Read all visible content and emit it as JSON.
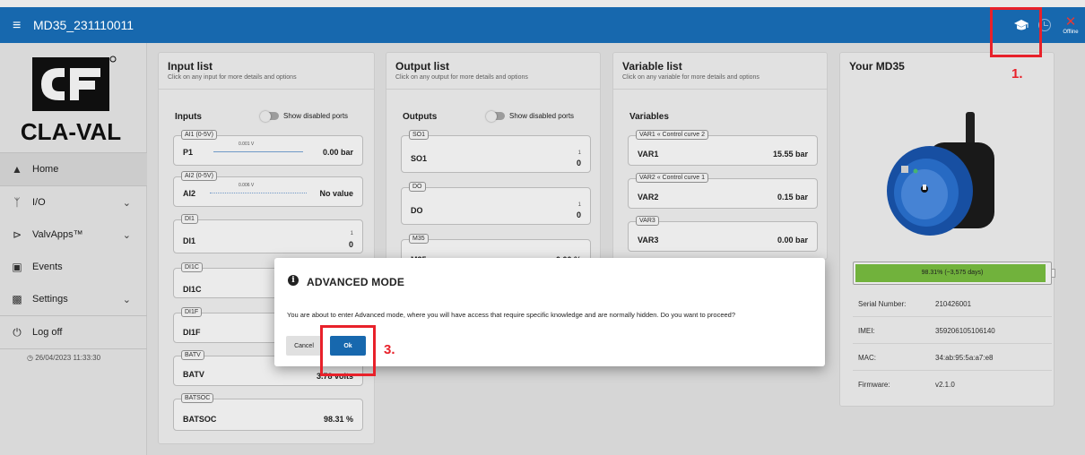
{
  "header": {
    "title": "MD35_231110011",
    "offline_label": "Offline"
  },
  "sidebar": {
    "logo_text": "CLA-VAL",
    "items": [
      {
        "label": "Home"
      },
      {
        "label": "I/O"
      },
      {
        "label": "ValvApps™"
      },
      {
        "label": "Events"
      },
      {
        "label": "Settings"
      },
      {
        "label": "Log off"
      }
    ],
    "timestamp": "26/04/2023 11:33:30"
  },
  "input_list": {
    "title": "Input list",
    "subtitle": "Click on any input for more details and options",
    "section": "Inputs",
    "toggle_label": "Show disabled ports",
    "cards": [
      {
        "tag": "AI1 (0-5V)",
        "name": "P1",
        "bar_label": "0.001 V",
        "value": "0.00 bar"
      },
      {
        "tag": "AI2 (0-5V)",
        "name": "AI2",
        "bar_label": "0.006 V",
        "value": "No value"
      },
      {
        "tag": "DI1",
        "name": "DI1",
        "small": "1",
        "value": "0"
      },
      {
        "tag": "DI1C",
        "name": "DI1C"
      },
      {
        "tag": "DI1F",
        "name": "DI1F"
      },
      {
        "tag": "BATV",
        "name": "BATV",
        "value": "3.78 volts"
      },
      {
        "tag": "BATSOC",
        "name": "BATSOC",
        "value": "98.31 %"
      }
    ]
  },
  "output_list": {
    "title": "Output list",
    "subtitle": "Click on any output for more details and options",
    "section": "Outputs",
    "toggle_label": "Show disabled ports",
    "cards": [
      {
        "tag": "SO1",
        "name": "SO1",
        "small": "1",
        "value": "0"
      },
      {
        "tag": "DO",
        "name": "DO",
        "small": "1",
        "value": "0"
      },
      {
        "tag": "M35",
        "name": "M35",
        "value": "0.00 %"
      }
    ]
  },
  "variable_list": {
    "title": "Variable list",
    "subtitle": "Click on any variable for more details and options",
    "section": "Variables",
    "cards": [
      {
        "tag": "VAR1 « Control curve 2",
        "name": "VAR1",
        "value": "15.55 bar"
      },
      {
        "tag": "VAR2 « Control curve 1",
        "name": "VAR2",
        "value": "0.15 bar"
      },
      {
        "tag": "VAR3",
        "name": "VAR3",
        "value": "0.00 bar"
      }
    ]
  },
  "device": {
    "title": "Your MD35",
    "battery_label": "98.31% (~3,575 days)",
    "battery_level": 0.9831,
    "info": [
      {
        "key": "Serial Number:",
        "value": "210426001"
      },
      {
        "key": "IMEI:",
        "value": "359206105106140"
      },
      {
        "key": "MAC:",
        "value": "34:ab:95:5a:a7:e8"
      },
      {
        "key": "Firmware:",
        "value": "v2.1.0"
      }
    ]
  },
  "dialog": {
    "title": "ADVANCED MODE",
    "message": "You are about to enter Advanced mode, where you will have access that require specific knowledge and are normally hidden. Do you want to proceed?",
    "cancel_label": "Cancel",
    "ok_label": "Ok"
  },
  "annotations": {
    "step1": "1.",
    "step3": "3."
  },
  "colors": {
    "primary": "#1768ae",
    "annotation": "#e8212a",
    "battery": "#7bc242",
    "offline": "#e53935"
  }
}
